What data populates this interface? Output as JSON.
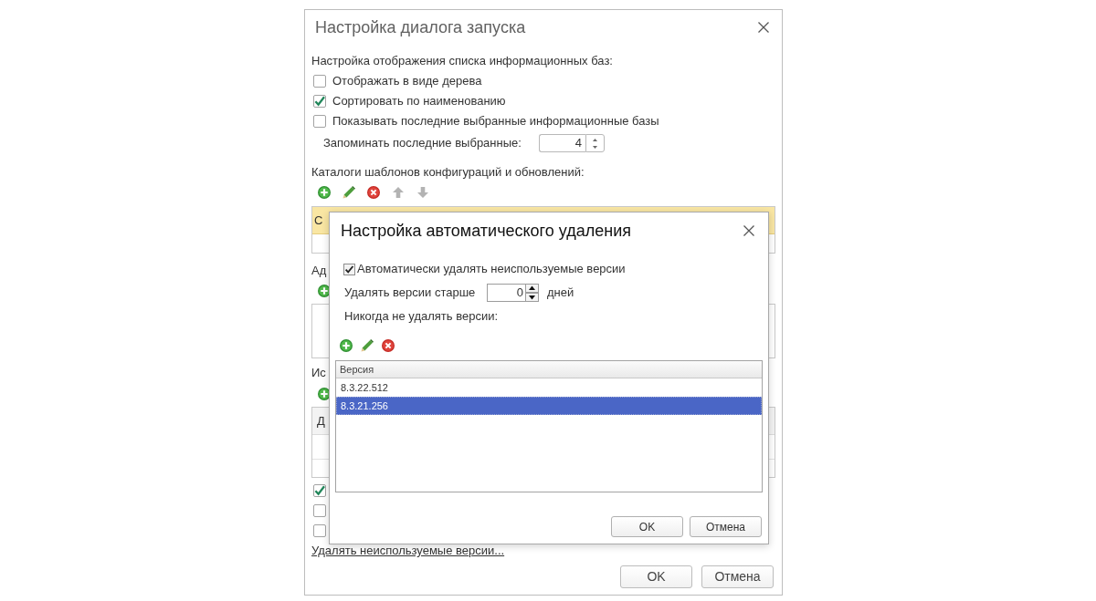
{
  "launch_dialog": {
    "title": "Настройка диалога запуска",
    "list_display": {
      "heading": "Настройка отображения списка информационных баз:",
      "options": [
        {
          "label": "Отображать в виде дерева",
          "checked": false
        },
        {
          "label": "Сортировать по наименованию",
          "checked": true
        },
        {
          "label": "Показывать последние выбранные информационные базы",
          "checked": false
        }
      ],
      "remember_recent": {
        "label": "Запоминать последние выбранные:",
        "value": "4"
      }
    },
    "template_catalogs": {
      "heading": "Каталоги шаблонов конфигураций и обновлений:",
      "toolbar": [
        {
          "kind": "add",
          "disabled": false
        },
        {
          "kind": "edit",
          "disabled": false
        },
        {
          "kind": "delete",
          "disabled": false
        },
        {
          "kind": "up",
          "disabled": true
        },
        {
          "kind": "down",
          "disabled": true
        }
      ],
      "rows": [
        {
          "text": "С",
          "selected": true
        }
      ]
    },
    "section_2": {
      "heading": "Ад",
      "toolbar": [
        {
          "kind": "add",
          "disabled": false
        }
      ]
    },
    "section_3": {
      "heading": "Ис",
      "toolbar": [
        {
          "kind": "add",
          "disabled": false
        }
      ],
      "columns": [
        "Д"
      ]
    },
    "bottom_options": [
      {
        "checked": true
      },
      {
        "checked": false
      },
      {
        "checked": false
      }
    ],
    "link": "Удалять неиспользуемые версии...",
    "buttons": [
      "OK",
      "Отмена"
    ]
  },
  "auto_delete_dialog": {
    "title": "Настройка автоматического удаления",
    "auto_delete": {
      "label": "Автоматически удалять неиспользуемые версии",
      "checked": true
    },
    "older_than": {
      "label": "Удалять версии старше",
      "value": "0",
      "unit": "дней"
    },
    "never_delete_label": "Никогда не удалять версии:",
    "toolbar": [
      {
        "kind": "add",
        "disabled": false
      },
      {
        "kind": "edit",
        "disabled": false
      },
      {
        "kind": "delete",
        "disabled": false
      }
    ],
    "table": {
      "columns": [
        "Версия"
      ],
      "rows": [
        {
          "version": "8.3.22.512",
          "selected": false
        },
        {
          "version": "8.3.21.256",
          "selected": true
        }
      ]
    },
    "buttons": [
      "OK",
      "Отмена"
    ]
  }
}
